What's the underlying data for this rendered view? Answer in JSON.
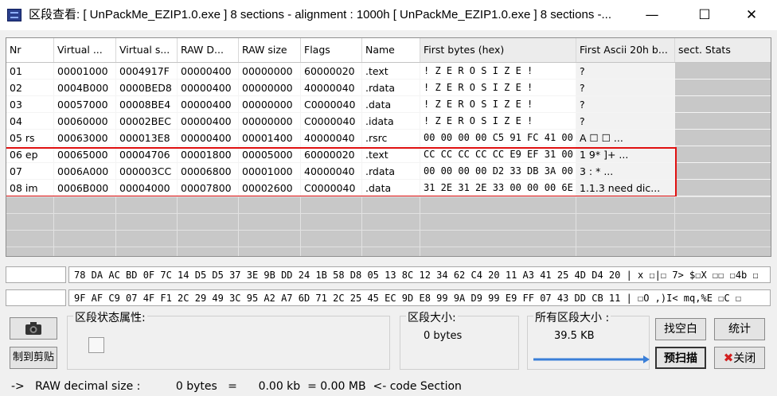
{
  "window": {
    "title": "区段查看: [ UnPackMe_EZIP1.0.exe ] 8 sections - alignment : 1000h [ UnPackMe_EZIP1.0.exe ] 8 sections -...",
    "minimize": "—",
    "maximize": "☐",
    "close": "✕"
  },
  "table": {
    "columns": [
      "Nr",
      "Virtual ...",
      "Virtual s...",
      "RAW D...",
      "RAW size",
      "Flags",
      "Name",
      "First bytes (hex)",
      "First Ascii 20h b...",
      "sect. Stats"
    ],
    "rows": [
      [
        "01",
        "00001000",
        "0004917F",
        "00000400",
        "00000000",
        "60000020",
        ".text",
        " ! Z E R O   S I Z E !",
        "?",
        ""
      ],
      [
        "02",
        "0004B000",
        "0000BED8",
        "00000400",
        "00000000",
        "40000040",
        ".rdata",
        " ! Z E R O   S I Z E !",
        "?",
        ""
      ],
      [
        "03",
        "00057000",
        "00008BE4",
        "00000400",
        "00000000",
        "C0000040",
        ".data",
        " ! Z E R O   S I Z E !",
        "?",
        ""
      ],
      [
        "04",
        "00060000",
        "00002BEC",
        "00000400",
        "00000000",
        "C0000040",
        ".idata",
        " ! Z E R O   S I Z E !",
        "?",
        ""
      ],
      [
        "05 rs",
        "00063000",
        "000013E8",
        "00000400",
        "00001400",
        "40000040",
        ".rsrc",
        "00 00 00 00 C5 91 FC 41 00",
        "      A     ☐ ☐ ...",
        ""
      ],
      [
        "06 ep",
        "00065000",
        "00004706",
        "00001800",
        "00005000",
        "60000020",
        ".text",
        "CC CC CC CC CC E9 EF 31 00",
        "        1   9*  ]+  ...",
        ""
      ],
      [
        "07",
        "0006A000",
        "000003CC",
        "00006800",
        "00001000",
        "40000040",
        ".rdata",
        "00 00 00 00 D2 33 DB 3A 00",
        "      3 :       *    ...",
        ""
      ],
      [
        "08 im",
        "0006B000",
        "00004000",
        "00007800",
        "00002600",
        "C0000040",
        ".data",
        "31 2E 31 2E 33 00 00 00 6E",
        " 1.1.3   need dic...",
        ""
      ]
    ]
  },
  "hex": {
    "line1": "78 DA AC BD 0F 7C 14 D5 D5 37 3E 9B DD 24 1B 58 D8 05 13 8C 12 34 62 C4 20 11 A3 41 25 4D D4 20   |   x  ☐|☐  7>  $☐X  ☐☐  ☐4b  ☐",
    "line2": "9F AF C9 07 4F F1 2C 29 49 3C 95 A2 A7 6D 71 2C 25 45 EC 9D E8 99 9A D9 99 E9 FF 07 43 DD CB 11   |   ☐O ,)I<   mq,%E        ☐C  ☐"
  },
  "panel": {
    "camera_icon": "camera-icon",
    "copy_clipboard": "制到剪贴",
    "section_attr_title": "区段状态属性:",
    "section_size_title": "区段大小:",
    "section_size_value": "0 bytes",
    "all_sections_title": "所有区段大小 :",
    "all_sections_value": "39.5 KB",
    "find_blank": "找空白",
    "stats": "统计",
    "prescan": "预扫描",
    "close": "关闭",
    "progress_fraction": 1.0,
    "accent_color": "#3a7fd8"
  },
  "status": {
    "text": "->   RAW decimal size :          0 bytes   =      0.00 kb  = 0.00 MB  <- code Section"
  }
}
